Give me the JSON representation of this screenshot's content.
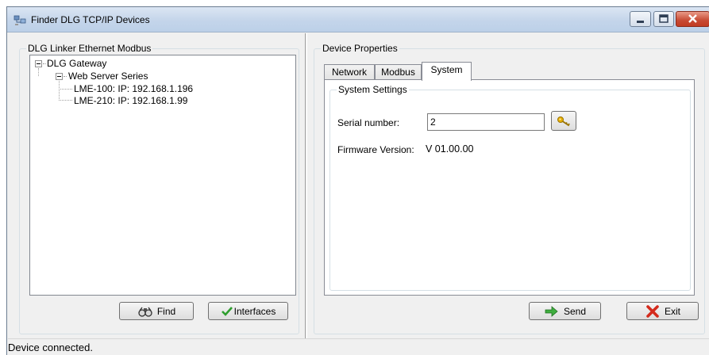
{
  "window": {
    "title": "Finder DLG TCP/IP Devices",
    "icon": "network-devices-icon"
  },
  "left_panel": {
    "group_title": "DLG Linker Ethernet Modbus",
    "tree": {
      "root": "DLG Gateway",
      "series": "Web Server Series",
      "devices": [
        "LME-100: IP: 192.168.1.196",
        "LME-210: IP: 192.168.1.99"
      ]
    },
    "find_label": "Find",
    "interfaces_label": "Interfaces"
  },
  "right_panel": {
    "group_title": "Device Properties",
    "tabs": [
      {
        "label": "Network",
        "active": false
      },
      {
        "label": "Modbus",
        "active": false
      },
      {
        "label": "System",
        "active": true
      }
    ],
    "system_settings": {
      "title": "System Settings",
      "serial_label": "Serial number:",
      "serial_value": "2",
      "firmware_label": "Firmware Version:",
      "firmware_value": "V 01.00.00"
    },
    "send_label": "Send",
    "exit_label": "Exit"
  },
  "status": {
    "text": "Device connected."
  },
  "colors": {
    "check_green": "#2e9e2e",
    "arrow_green": "#3fae3f",
    "exit_red": "#d42a1c",
    "key_yellow": "#e8b000"
  }
}
